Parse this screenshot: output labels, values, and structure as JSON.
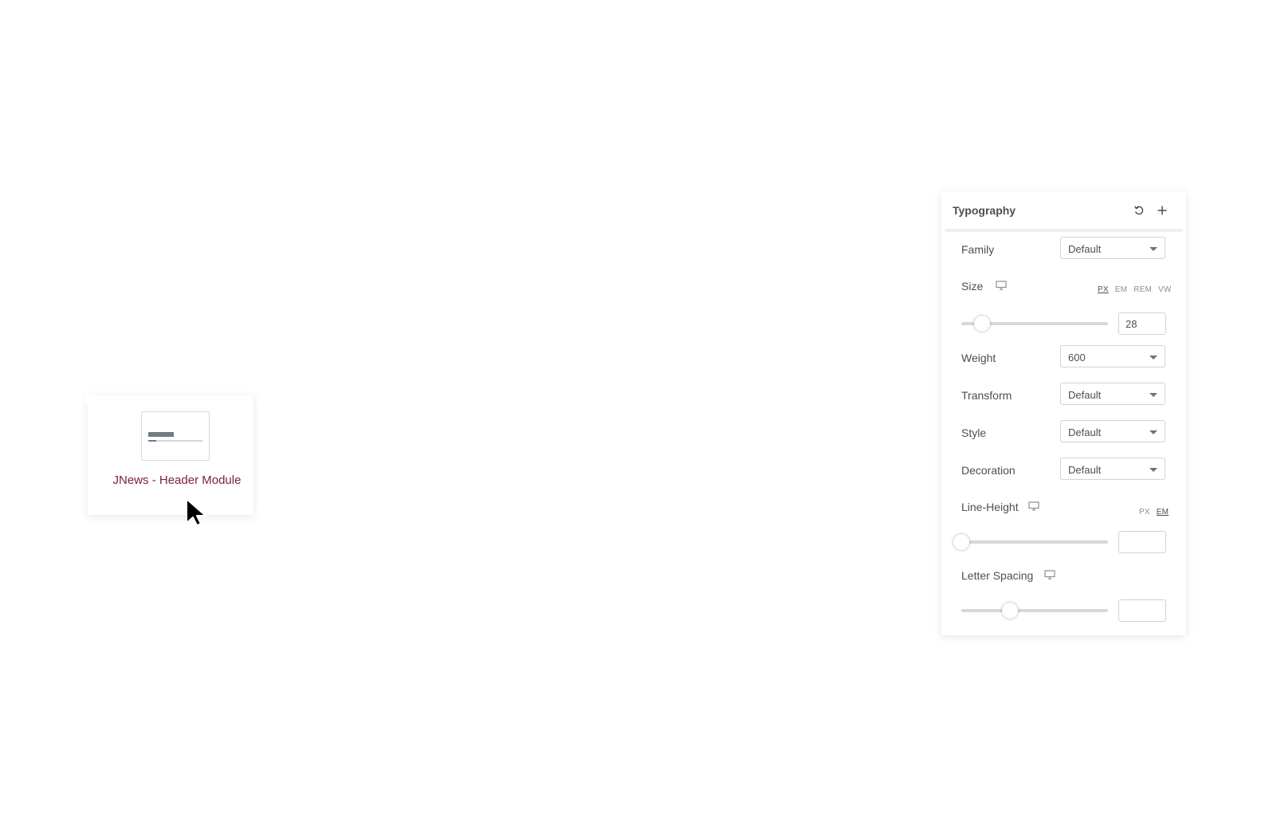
{
  "widget": {
    "label": "JNews - Header Module"
  },
  "panel": {
    "title": "Typography",
    "family": {
      "label": "Family",
      "value": "Default"
    },
    "size": {
      "label": "Size",
      "units": [
        "PX",
        "EM",
        "REM",
        "VW"
      ],
      "active_unit": "PX",
      "value": "28",
      "slider_fraction": 0.14
    },
    "weight": {
      "label": "Weight",
      "value": "600"
    },
    "transform": {
      "label": "Transform",
      "value": "Default"
    },
    "style": {
      "label": "Style",
      "value": "Default"
    },
    "decoration": {
      "label": "Decoration",
      "value": "Default"
    },
    "line_height": {
      "label": "Line-Height",
      "units": [
        "PX",
        "EM"
      ],
      "active_unit": "EM",
      "value": "",
      "slider_fraction": 0.0
    },
    "letter_spacing": {
      "label": "Letter Spacing",
      "value": "",
      "slider_fraction": 0.33
    }
  },
  "icons": {
    "reset": "reset-icon",
    "add": "plus-icon",
    "responsive": "monitor-icon",
    "cursor": "mouse-pointer-icon"
  }
}
